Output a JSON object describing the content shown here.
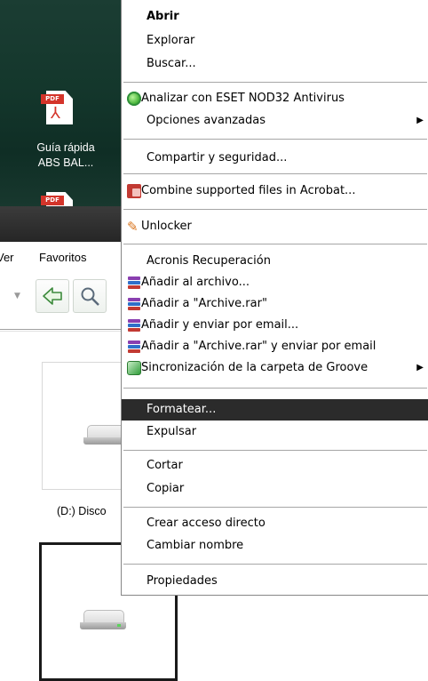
{
  "desktop": {
    "icon_badge": "PDF",
    "icon_label_line1": "Guía rápida",
    "icon_label_line2": "ABS BAL..."
  },
  "explorer": {
    "menu_partial_1": "Ver",
    "menu_favorites": "Favoritos",
    "drive_label": "(D:) Disco"
  },
  "context_menu": {
    "items": [
      {
        "label": "Abrir",
        "bold": true
      },
      {
        "label": "Explorar"
      },
      {
        "label": "Buscar..."
      },
      {
        "label": "Analizar con ESET NOD32 Antivirus",
        "icon": "eset-icon"
      },
      {
        "label": "Opciones avanzadas",
        "submenu": true
      },
      {
        "label": "Compartir y seguridad..."
      },
      {
        "label": "Combine supported files in Acrobat...",
        "icon": "acrobat-icon"
      },
      {
        "label": "Unlocker",
        "icon": "unlocker-icon"
      },
      {
        "label": "Acronis Recuperación"
      },
      {
        "label": "Añadir al archivo...",
        "icon": "winrar-icon"
      },
      {
        "label": "Añadir a \"Archive.rar\"",
        "icon": "winrar-icon"
      },
      {
        "label": "Añadir y enviar por email...",
        "icon": "winrar-icon"
      },
      {
        "label": "Añadir a \"Archive.rar\" y enviar por email",
        "icon": "winrar-icon"
      },
      {
        "label": "Sincronización de la carpeta de Groove",
        "icon": "groove-icon",
        "submenu": true
      },
      {
        "label": "Formatear...",
        "highlighted": true
      },
      {
        "label": "Expulsar"
      },
      {
        "label": "Cortar"
      },
      {
        "label": "Copiar"
      },
      {
        "label": "Crear acceso directo"
      },
      {
        "label": "Cambiar nombre"
      },
      {
        "label": "Propiedades"
      }
    ],
    "submenu_glyph": "▶"
  },
  "colors": {
    "highlight_bg": "#2b2b2b",
    "desktop_bg": "#14372c"
  }
}
